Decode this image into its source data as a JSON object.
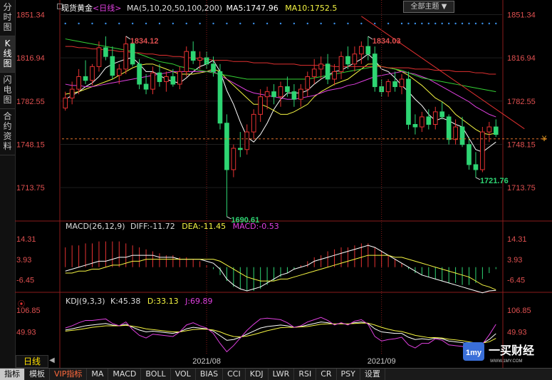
{
  "sidebar": {
    "tabs": [
      {
        "label": "分时图",
        "active": false
      },
      {
        "label": "K线图",
        "active": true
      },
      {
        "label": "闪电图",
        "active": false
      },
      {
        "label": "合约资料",
        "active": false
      }
    ]
  },
  "main": {
    "symbol": "现货黄金",
    "period": "<日线>",
    "ma_label": "MA(5,10,20,50,100,200)",
    "ma5": "MA5:1747.96",
    "ma10": "MA10:1752.5",
    "theme_button": "全部主题",
    "last_price_marker": "¥"
  },
  "indicators": {
    "macd": {
      "label": "MACD(26,12,9)",
      "diff": "DIFF:-11.72",
      "dea": "DEA:-11.45",
      "macd": "MACD:-0.53"
    },
    "kdj": {
      "label": "KDJ(9,3,3)",
      "k": "K:45.38",
      "d": "D:33.13",
      "j": "J:69.89"
    }
  },
  "bottom": {
    "period_label": "日线",
    "tabs": [
      "指标",
      "模板",
      "VIP指标",
      "MA",
      "MACD",
      "BOLL",
      "VOL",
      "BIAS",
      "CCI",
      "KDJ",
      "LWR",
      "RSI",
      "CR",
      "PSY",
      "设置"
    ],
    "active_tab": "指标",
    "vip_tab": "VIP指标"
  },
  "logo": {
    "name": "一买财经",
    "url": "WWW.1MY.COM"
  },
  "colors": {
    "up": "#e63232",
    "down": "#2ed573",
    "ma5": "#ffffff",
    "ma10": "#f5f542",
    "ma20": "#e040e0",
    "ma50": "#35d235",
    "ma100": "#e03030",
    "ma200": "#e03030",
    "diff": "#ffffff",
    "dea": "#f5f542",
    "k": "#ffffff",
    "d": "#f5f542",
    "j": "#e040e0"
  },
  "chart_data": {
    "type": "candlestick",
    "price_axis": {
      "ticks": [
        "1851.34",
        "1816.94",
        "1782.55",
        "1748.15",
        "1713.75"
      ],
      "min": 1690,
      "max": 1855
    },
    "x_labels": [
      {
        "label": "2021/08",
        "index": 21
      },
      {
        "label": "2021/09",
        "index": 47
      }
    ],
    "annotations": [
      {
        "text": "1834.12",
        "index": 9,
        "value": 1834.12,
        "type": "high"
      },
      {
        "text": "1834.03",
        "index": 45,
        "value": 1834.03,
        "type": "high"
      },
      {
        "text": "1690.61",
        "index": 24,
        "value": 1690.61,
        "type": "low"
      },
      {
        "text": "1721.76",
        "index": 61,
        "value": 1721.76,
        "type": "low"
      }
    ],
    "ohlc": [
      [
        1777,
        1790,
        1775,
        1785
      ],
      [
        1785,
        1798,
        1780,
        1792
      ],
      [
        1792,
        1808,
        1788,
        1802
      ],
      [
        1802,
        1815,
        1796,
        1799
      ],
      [
        1799,
        1812,
        1795,
        1810
      ],
      [
        1810,
        1830,
        1806,
        1825
      ],
      [
        1825,
        1834,
        1815,
        1818
      ],
      [
        1818,
        1826,
        1800,
        1803
      ],
      [
        1803,
        1812,
        1796,
        1808
      ],
      [
        1808,
        1834.12,
        1804,
        1828
      ],
      [
        1828,
        1832,
        1810,
        1812
      ],
      [
        1812,
        1816,
        1792,
        1796
      ],
      [
        1796,
        1804,
        1788,
        1792
      ],
      [
        1792,
        1810,
        1788,
        1805
      ],
      [
        1805,
        1812,
        1794,
        1798
      ],
      [
        1798,
        1806,
        1790,
        1802
      ],
      [
        1802,
        1808,
        1794,
        1796
      ],
      [
        1796,
        1810,
        1792,
        1806
      ],
      [
        1806,
        1826,
        1802,
        1822
      ],
      [
        1822,
        1830,
        1812,
        1815
      ],
      [
        1815,
        1822,
        1808,
        1817
      ],
      [
        1817,
        1822,
        1808,
        1812
      ],
      [
        1812,
        1818,
        1802,
        1806
      ],
      [
        1806,
        1812,
        1760,
        1765
      ],
      [
        1765,
        1772,
        1690.61,
        1728
      ],
      [
        1728,
        1748,
        1722,
        1745
      ],
      [
        1745,
        1758,
        1738,
        1744
      ],
      [
        1744,
        1764,
        1740,
        1758
      ],
      [
        1758,
        1776,
        1752,
        1772
      ],
      [
        1772,
        1792,
        1766,
        1786
      ],
      [
        1786,
        1794,
        1776,
        1790
      ],
      [
        1790,
        1796,
        1780,
        1786
      ],
      [
        1786,
        1798,
        1778,
        1794
      ],
      [
        1794,
        1802,
        1786,
        1790
      ],
      [
        1790,
        1796,
        1778,
        1784
      ],
      [
        1784,
        1796,
        1778,
        1792
      ],
      [
        1792,
        1806,
        1786,
        1802
      ],
      [
        1802,
        1816,
        1796,
        1808
      ],
      [
        1808,
        1818,
        1800,
        1812
      ],
      [
        1812,
        1820,
        1796,
        1800
      ],
      [
        1800,
        1812,
        1795,
        1806
      ],
      [
        1806,
        1822,
        1800,
        1818
      ],
      [
        1818,
        1826,
        1808,
        1812
      ],
      [
        1812,
        1826,
        1806,
        1820
      ],
      [
        1820,
        1830,
        1812,
        1826
      ],
      [
        1826,
        1834.03,
        1815,
        1820
      ],
      [
        1820,
        1826,
        1790,
        1794
      ],
      [
        1794,
        1800,
        1786,
        1790
      ],
      [
        1790,
        1800,
        1786,
        1798
      ],
      [
        1798,
        1806,
        1790,
        1794
      ],
      [
        1794,
        1804,
        1788,
        1800
      ],
      [
        1800,
        1806,
        1760,
        1764
      ],
      [
        1764,
        1772,
        1756,
        1762
      ],
      [
        1762,
        1774,
        1758,
        1770
      ],
      [
        1770,
        1776,
        1760,
        1764
      ],
      [
        1764,
        1778,
        1760,
        1774
      ],
      [
        1774,
        1782,
        1768,
        1770
      ],
      [
        1770,
        1772,
        1748,
        1752
      ],
      [
        1752,
        1768,
        1748,
        1762
      ],
      [
        1762,
        1770,
        1746,
        1748
      ],
      [
        1748,
        1754,
        1728,
        1732
      ],
      [
        1732,
        1742,
        1721.76,
        1728
      ],
      [
        1728,
        1762,
        1726,
        1758
      ],
      [
        1758,
        1766,
        1750,
        1762
      ],
      [
        1762,
        1768,
        1754,
        1756
      ]
    ],
    "ma_series": [
      {
        "name": "MA5",
        "values": [
          1784,
          1787,
          1790,
          1794,
          1797,
          1802,
          1809,
          1812,
          1814,
          1816,
          1817,
          1812,
          1806,
          1806,
          1803,
          1800,
          1798,
          1797,
          1801,
          1806,
          1810,
          1812,
          1815,
          1806,
          1791,
          1780,
          1766,
          1754,
          1750,
          1756,
          1765,
          1776,
          1784,
          1789,
          1789,
          1789,
          1791,
          1796,
          1800,
          1803,
          1806,
          1807,
          1810,
          1813,
          1816,
          1820,
          1815,
          1808,
          1806,
          1801,
          1795,
          1790,
          1784,
          1779,
          1772,
          1767,
          1769,
          1767,
          1764,
          1762,
          1753,
          1744,
          1742,
          1746,
          1750
        ]
      },
      {
        "name": "MA10",
        "values": [
          1788,
          1789,
          1790,
          1792,
          1794,
          1796,
          1798,
          1800,
          1803,
          1806,
          1809,
          1811,
          1812,
          1812,
          1810,
          1808,
          1806,
          1804,
          1804,
          1804,
          1805,
          1806,
          1808,
          1806,
          1800,
          1795,
          1790,
          1785,
          1780,
          1780,
          1778,
          1775,
          1772,
          1772,
          1774,
          1777,
          1780,
          1786,
          1790,
          1793,
          1796,
          1798,
          1800,
          1804,
          1808,
          1812,
          1812,
          1810,
          1809,
          1808,
          1806,
          1803,
          1799,
          1795,
          1790,
          1785,
          1782,
          1778,
          1772,
          1768,
          1764,
          1760,
          1757,
          1756,
          1757
        ]
      },
      {
        "name": "MA20",
        "values": [
          1796,
          1795,
          1795,
          1794,
          1794,
          1795,
          1796,
          1797,
          1798,
          1799,
          1800,
          1801,
          1802,
          1803,
          1804,
          1805,
          1806,
          1806,
          1806,
          1806,
          1806,
          1806,
          1806,
          1803,
          1800,
          1797,
          1794,
          1791,
          1789,
          1788,
          1787,
          1786,
          1785,
          1784,
          1784,
          1785,
          1786,
          1787,
          1789,
          1791,
          1792,
          1793,
          1795,
          1796,
          1798,
          1800,
          1802,
          1803,
          1804,
          1805,
          1806,
          1805,
          1804,
          1802,
          1800,
          1797,
          1794,
          1791,
          1788,
          1785,
          1782,
          1778,
          1775,
          1772,
          1770
        ]
      },
      {
        "name": "MA50",
        "values": [
          1832,
          1831,
          1830,
          1829,
          1828,
          1827,
          1826,
          1825,
          1824,
          1823,
          1822,
          1820,
          1818,
          1816,
          1814,
          1813,
          1812,
          1810,
          1809,
          1808,
          1807,
          1806,
          1805,
          1804,
          1803,
          1802,
          1801,
          1800,
          1800,
          1800,
          1800,
          1800,
          1800,
          1800,
          1800,
          1800,
          1800,
          1801,
          1802,
          1803,
          1804,
          1805,
          1806,
          1807,
          1808,
          1809,
          1810,
          1810,
          1809,
          1808,
          1807,
          1805,
          1803,
          1801,
          1800,
          1799,
          1798,
          1797,
          1796,
          1795,
          1794,
          1793,
          1792,
          1791,
          1790
        ]
      },
      {
        "name": "MA100",
        "values": [
          1826,
          1826,
          1825,
          1825,
          1824,
          1824,
          1823,
          1823,
          1822,
          1822,
          1821,
          1821,
          1820,
          1820,
          1819,
          1819,
          1818,
          1818,
          1817,
          1817,
          1816,
          1816,
          1815,
          1815,
          1815,
          1814,
          1814,
          1814,
          1813,
          1813,
          1813,
          1812,
          1812,
          1812,
          1812,
          1811,
          1811,
          1811,
          1811,
          1811,
          1810,
          1810,
          1810,
          1810,
          1810,
          1810,
          1810,
          1810,
          1809,
          1809,
          1809,
          1809,
          1808,
          1808,
          1808,
          1807,
          1807,
          1807,
          1806,
          1806,
          1806,
          1805,
          1805,
          1804,
          1804
        ]
      }
    ],
    "trendline": {
      "from": {
        "index": 44,
        "value": 1850
      },
      "to": {
        "index": 64,
        "value": 1752
      }
    },
    "last_price": 1752.5,
    "macd": {
      "ticks": [
        "14.31",
        "3.93",
        "-6.45"
      ],
      "min": -12,
      "max": 19,
      "hist": [
        10,
        11,
        11,
        12,
        12,
        13,
        13,
        13,
        13,
        12,
        11,
        10,
        9,
        8,
        7,
        6,
        6,
        5,
        5,
        4,
        3,
        1,
        -1,
        -4,
        -7,
        -10,
        -11,
        -12,
        -12,
        -11,
        -9,
        -7,
        -5,
        -3,
        -1,
        1,
        3,
        5,
        6,
        8,
        9,
        10,
        10,
        11,
        12,
        12,
        10,
        8,
        6,
        4,
        2,
        -1,
        -3,
        -4,
        -5,
        -6,
        -7,
        -8,
        -8,
        -9,
        -9,
        -8,
        -6,
        -3,
        -1
      ],
      "diff": [
        -2,
        -1,
        0,
        1,
        2,
        3,
        3,
        4,
        5,
        5,
        6,
        6,
        6,
        6,
        5,
        5,
        5,
        4,
        4,
        4,
        4,
        3,
        2,
        -1,
        -6,
        -9,
        -11,
        -12,
        -11,
        -10,
        -8,
        -6,
        -4,
        -3,
        -1,
        0,
        1,
        3,
        4,
        5,
        6,
        7,
        8,
        9,
        10,
        11,
        10,
        8,
        6,
        4,
        2,
        0,
        -2,
        -4,
        -5,
        -6,
        -7,
        -8,
        -9,
        -10,
        -11,
        -12,
        -13,
        -12,
        -11.72
      ],
      "dea": [
        -3,
        -3,
        -2,
        -2,
        -1,
        -1,
        0,
        1,
        1,
        2,
        3,
        3,
        4,
        4,
        4,
        4,
        4,
        4,
        4,
        4,
        4,
        4,
        4,
        3,
        1,
        -1,
        -3,
        -5,
        -6,
        -7,
        -7,
        -7,
        -6,
        -6,
        -5,
        -4,
        -3,
        -2,
        -1,
        0,
        1,
        2,
        3,
        4,
        5,
        6,
        6,
        6,
        6,
        5,
        5,
        4,
        3,
        2,
        1,
        0,
        -1,
        -2,
        -3,
        -4,
        -5,
        -7,
        -9,
        -10,
        -11.45
      ]
    },
    "kdj": {
      "ticks": [
        "106.85",
        "49.93"
      ],
      "min": -5,
      "max": 120,
      "k": [
        55,
        58,
        62,
        66,
        68,
        70,
        72,
        68,
        66,
        70,
        62,
        55,
        50,
        52,
        50,
        48,
        46,
        50,
        58,
        62,
        60,
        58,
        52,
        40,
        28,
        30,
        36,
        44,
        52,
        60,
        64,
        66,
        68,
        66,
        62,
        64,
        68,
        72,
        76,
        74,
        70,
        72,
        70,
        74,
        76,
        72,
        58,
        50,
        48,
        46,
        46,
        36,
        30,
        32,
        30,
        34,
        32,
        26,
        24,
        22,
        18,
        14,
        20,
        30,
        45.38
      ],
      "d": [
        52,
        54,
        56,
        59,
        62,
        64,
        66,
        66,
        66,
        67,
        65,
        62,
        58,
        56,
        54,
        52,
        50,
        50,
        53,
        56,
        57,
        57,
        55,
        50,
        43,
        38,
        37,
        39,
        43,
        48,
        53,
        57,
        61,
        62,
        62,
        63,
        64,
        67,
        70,
        71,
        71,
        71,
        71,
        72,
        73,
        73,
        68,
        62,
        57,
        53,
        51,
        46,
        41,
        38,
        35,
        35,
        34,
        31,
        29,
        27,
        24,
        21,
        21,
        24,
        33.13
      ],
      "j": [
        60,
        66,
        74,
        80,
        80,
        82,
        84,
        72,
        66,
        76,
        56,
        41,
        34,
        44,
        42,
        40,
        38,
        50,
        68,
        74,
        66,
        60,
        46,
        20,
        -2,
        14,
        34,
        54,
        70,
        84,
        86,
        84,
        82,
        74,
        62,
        66,
        76,
        82,
        88,
        80,
        68,
        74,
        68,
        78,
        82,
        70,
        38,
        26,
        30,
        32,
        36,
        16,
        8,
        20,
        20,
        32,
        28,
        16,
        14,
        12,
        6,
        0,
        18,
        42,
        69.89
      ]
    }
  }
}
